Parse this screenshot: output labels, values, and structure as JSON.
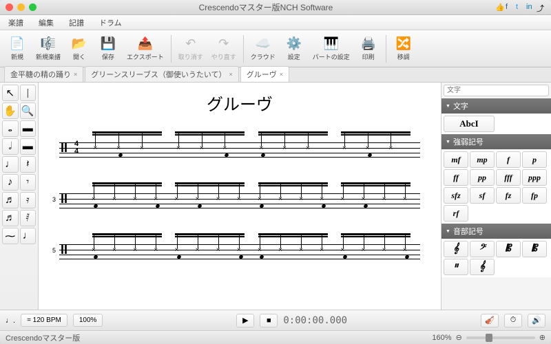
{
  "window": {
    "title": "Crescendoマスター版NCH Software"
  },
  "menu": {
    "m0": "楽譜",
    "m1": "編集",
    "m2": "記譜",
    "m3": "ドラム"
  },
  "toolbar": {
    "new": "新規",
    "newscore": "新規楽譜",
    "open": "開く",
    "save": "保存",
    "export": "エクスポート",
    "undo": "取り消す",
    "redo": "やり直す",
    "cloud": "クラウド",
    "settings": "設定",
    "partsettings": "パートの設定",
    "print": "印刷",
    "transpose": "移調"
  },
  "tabs": {
    "t0": "金平糖の精の踊り",
    "t1": "グリーンスリーブス（御使いうたいて）",
    "t2": "グルーヴ"
  },
  "score": {
    "title": "グルーヴ",
    "clef": "II",
    "ts_top": "4",
    "ts_bot": "4",
    "m2": "3",
    "m3": "5"
  },
  "rpanel": {
    "search_ph": "文字",
    "h_text": "文字",
    "text_sample": "AbcI",
    "h_dyn": "強弱記号",
    "d0": "mf",
    "d1": "mp",
    "d2": "f",
    "d3": "p",
    "d4": "ff",
    "d5": "pp",
    "d6": "fff",
    "d7": "ppp",
    "d8": "sfz",
    "d9": "sf",
    "d10": "fz",
    "d11": "fp",
    "d12": "rf",
    "h_clef": "音部記号"
  },
  "play": {
    "tempo_note": "♩.",
    "tempo": "= 120 BPM",
    "zoom": "100%",
    "time": "0:00:00.000"
  },
  "status": {
    "app": "Crescendoマスター版",
    "zoom": "160%"
  }
}
